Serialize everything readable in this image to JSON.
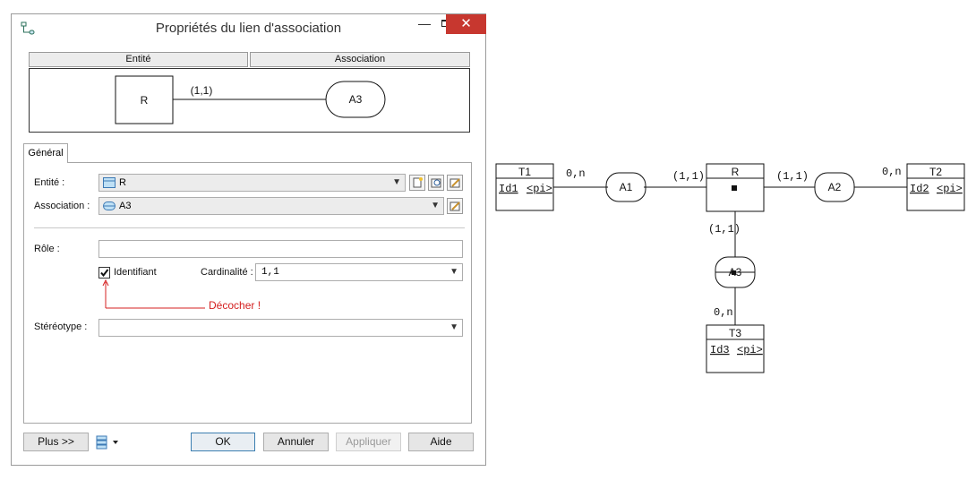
{
  "dialog": {
    "title": "Propriétés du lien d'association",
    "header_tabs": {
      "entity": "Entité",
      "association": "Association"
    },
    "preview": {
      "entity": "R",
      "cardinality": "(1,1)",
      "association": "A3"
    },
    "general_tab": "Général",
    "fields": {
      "entity_label": "Entité :",
      "entity_value": "R",
      "association_label": "Association :",
      "association_value": "A3",
      "role_label": "Rôle :",
      "role_value": "",
      "identifiant_label": "Identifiant",
      "identifiant_checked": true,
      "cardinality_label": "Cardinalité :",
      "cardinality_value": "1,1",
      "stereotype_label": "Stéréotype :",
      "stereotype_value": ""
    },
    "annotation": {
      "text": "Décocher !",
      "color": "#d42020"
    },
    "buttons": {
      "more": "Plus >>",
      "ok": "OK",
      "cancel": "Annuler",
      "apply": "Appliquer",
      "help": "Aide"
    },
    "icons": [
      "link-icon",
      "minimize-icon",
      "maximize-icon",
      "close-icon",
      "entity-icon",
      "association-icon",
      "new-icon",
      "browse-icon",
      "properties-icon",
      "list-icon"
    ]
  },
  "diagram": {
    "entities": {
      "t1": {
        "name": "T1",
        "id": "Id1",
        "pi": "<pi>"
      },
      "r": {
        "name": "R"
      },
      "t2": {
        "name": "T2",
        "id": "Id2",
        "pi": "<pi>"
      },
      "t3": {
        "name": "T3",
        "id": "Id3",
        "pi": "<pi>"
      }
    },
    "associations": {
      "a1": "A1",
      "a2": "A2",
      "a3": "A3"
    },
    "cardinalities": {
      "t1_a1": "0,n",
      "a1_r": "(1,1)",
      "r_a2": "(1,1)",
      "a2_t2": "0,n",
      "r_a3": "(1,1)",
      "a3_t3": "0,n"
    }
  }
}
